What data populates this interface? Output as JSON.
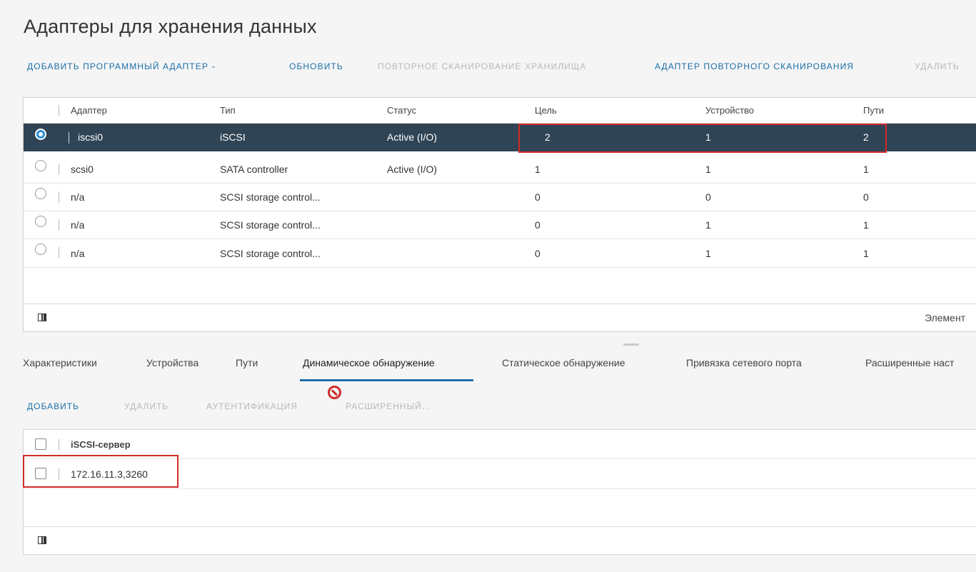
{
  "page": {
    "title": "Адаптеры для хранения данных"
  },
  "toolbar": {
    "add_software_adapter": "ДОБАВИТЬ ПРОГРАММНЫЙ АДАПТЕР",
    "refresh": "ОБНОВИТЬ",
    "rescan_storage": "ПОВТОРНОЕ СКАНИРОВАНИЕ ХРАНИЛИЩА",
    "rescan_adapter": "АДАПТЕР ПОВТОРНОГО СКАНИРОВАНИЯ",
    "remove": "УДАЛИТЬ"
  },
  "adapters_table": {
    "columns": [
      "Адаптер",
      "Тип",
      "Статус",
      "Цель",
      "Устройство",
      "Пути"
    ],
    "rows": [
      {
        "adapter": "iscsi0",
        "type": "iSCSI",
        "status": "Active (I/O)",
        "target": "2",
        "device": "1",
        "paths": "2",
        "selected": true
      },
      {
        "adapter": "scsi0",
        "type": "SATA controller",
        "status": "Active (I/O)",
        "target": "1",
        "device": "1",
        "paths": "1",
        "selected": false
      },
      {
        "adapter": "n/a",
        "type": "SCSI storage control...",
        "status": "",
        "target": "0",
        "device": "0",
        "paths": "0",
        "selected": false
      },
      {
        "adapter": "n/a",
        "type": "SCSI storage control...",
        "status": "",
        "target": "0",
        "device": "1",
        "paths": "1",
        "selected": false
      },
      {
        "adapter": "n/a",
        "type": "SCSI storage control...",
        "status": "",
        "target": "0",
        "device": "1",
        "paths": "1",
        "selected": false
      }
    ],
    "footer_text": "Элемент"
  },
  "tabs": {
    "items": [
      {
        "label": "Характеристики"
      },
      {
        "label": "Устройства"
      },
      {
        "label": "Пути"
      },
      {
        "label": "Динамическое обнаружение"
      },
      {
        "label": "Статическое обнаружение"
      },
      {
        "label": "Привязка сетевого порта"
      },
      {
        "label": "Расширенные наст"
      }
    ],
    "active": "Динамическое обнаружение"
  },
  "discovery_toolbar": {
    "add": "ДОБАВИТЬ",
    "remove": "УДАЛИТЬ",
    "authentication": "АУТЕНТИФИКАЦИЯ",
    "advanced": "РАСШИРЕННЫЙ..."
  },
  "servers_table": {
    "column": "iSCSI-сервер",
    "rows": [
      {
        "server": "172.16.11.3,3260"
      }
    ]
  },
  "colors": {
    "accent": "#1a6fa8",
    "selected_row": "#2f4455",
    "highlight": "#d12a2a",
    "disabled": "#b8b8b8"
  },
  "icons": {
    "toolbar_dropdown": "chevron-down-icon",
    "column_toggle": "columns-icon",
    "cursor_indicator": "not-allowed-icon"
  }
}
